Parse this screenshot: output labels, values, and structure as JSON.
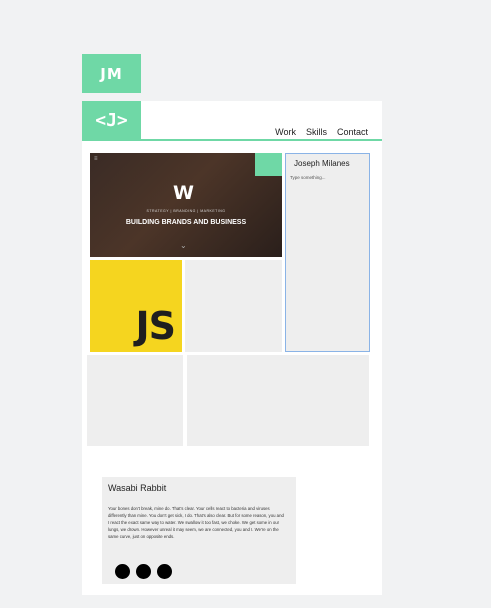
{
  "header": {
    "logo_text": "JM",
    "card_logo_text": "<J>"
  },
  "nav": {
    "items": [
      "Work",
      "Skills",
      "Contact"
    ]
  },
  "hero": {
    "menu_glyph": "≡",
    "brand_mark": "W",
    "subtitle": "STRATEGY | BRANDING | MARKETING",
    "title": "BUILDING BRANDS AND BUSINESS",
    "scroll_glyph": "⌄"
  },
  "side_panel": {
    "name": "Joseph Milanes",
    "placeholder": "Type something..."
  },
  "tiles": {
    "js_label": "JS"
  },
  "quote": {
    "title": "Wasabi Rabbit",
    "body": "Your bones don't break, mine do. That's clear. Your cells react to bacteria and viruses differently than mine. You don't get sick, I do. That's also clear. But for some reason, you and I react the exact same way to water. We swallow it too fast, we choke. We get some in our lungs, we drown. However unreal it may seem, we are connected, you and I. We're on the same curve, just on opposite ends.",
    "dots_count": 3
  },
  "colors": {
    "accent": "#6fd8a6",
    "js_yellow": "#f5d51f",
    "panel_border": "#8ab3e6"
  }
}
